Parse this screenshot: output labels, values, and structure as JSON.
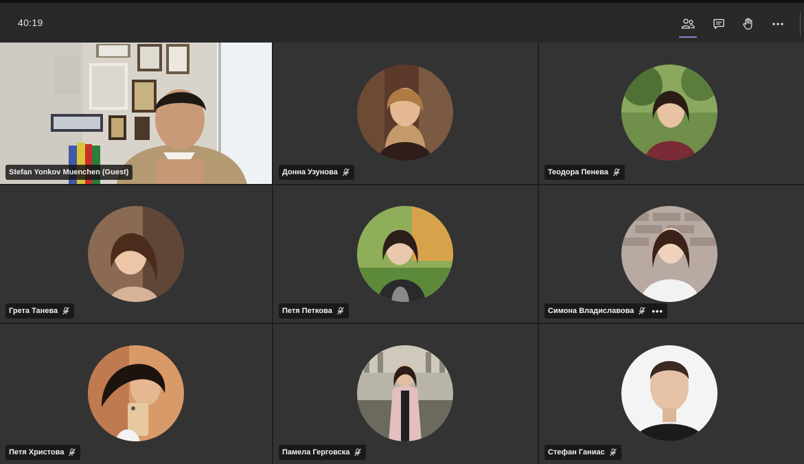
{
  "meeting": {
    "timer": "40:19"
  },
  "toolbar": {
    "buttons": [
      {
        "name": "participants-button",
        "icon": "people-icon",
        "active": true
      },
      {
        "name": "chat-button",
        "icon": "chat-icon",
        "active": false
      },
      {
        "name": "raise-hand-button",
        "icon": "hand-icon",
        "active": false
      },
      {
        "name": "more-actions-button",
        "icon": "more-icon",
        "active": false
      }
    ]
  },
  "participants": [
    {
      "name": "Stefan Yonkov Muenchen (Guest)",
      "video": true,
      "muted": false
    },
    {
      "name": "Донна Узунова",
      "video": false,
      "muted": true
    },
    {
      "name": "Теодора Пенева",
      "video": false,
      "muted": true
    },
    {
      "name": "Грета Танева",
      "video": false,
      "muted": true
    },
    {
      "name": "Петя Петкова",
      "video": false,
      "muted": true
    },
    {
      "name": "Симона Владиславова",
      "video": false,
      "muted": true,
      "more": "•••"
    },
    {
      "name": "Петя Христова",
      "video": false,
      "muted": true
    },
    {
      "name": "Памела Герговска",
      "video": false,
      "muted": true
    },
    {
      "name": "Стефан Ганиас",
      "video": false,
      "muted": true
    }
  ],
  "colors": {
    "topbar": "#292929",
    "tile": "#333333",
    "accent": "#8b8cc7"
  }
}
